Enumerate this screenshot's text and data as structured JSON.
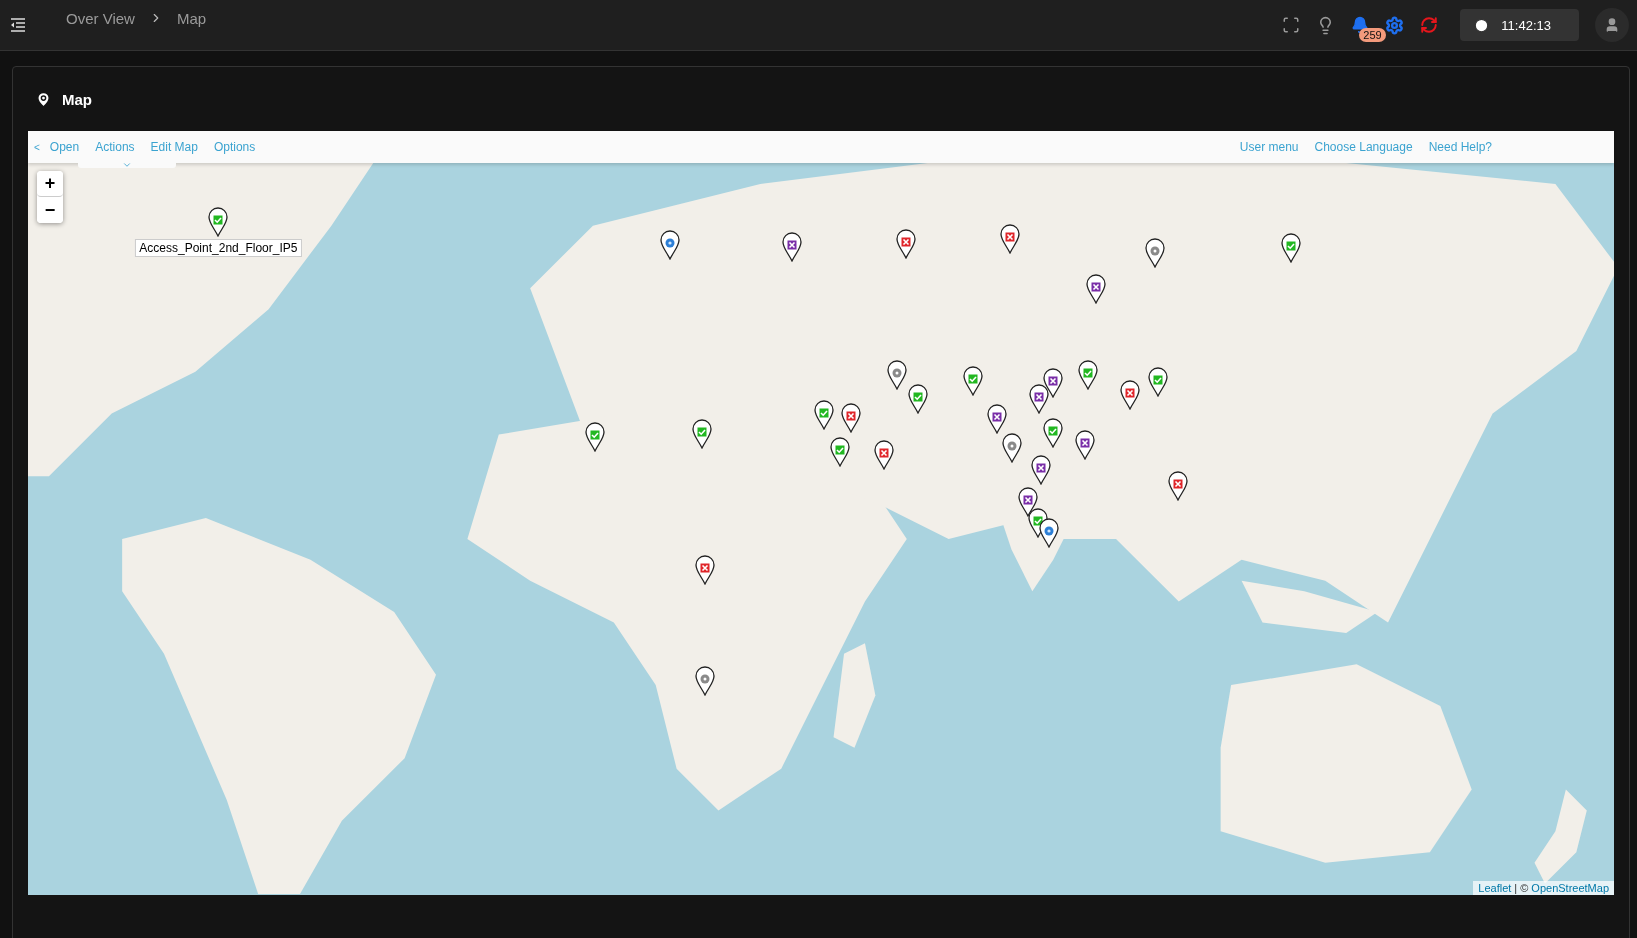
{
  "topbar": {
    "breadcrumbs": [
      {
        "label": "Over View"
      },
      {
        "label": "Map"
      }
    ],
    "notifications": {
      "count": "259"
    },
    "clock": "11:42:13"
  },
  "panel": {
    "title": "Map"
  },
  "map_menu": {
    "back": "<",
    "left": [
      {
        "label": "Open"
      },
      {
        "label": "Actions"
      },
      {
        "label": "Edit Map"
      },
      {
        "label": "Options"
      }
    ],
    "right": [
      {
        "label": "User menu"
      },
      {
        "label": "Choose Language"
      },
      {
        "label": "Need Help?"
      }
    ]
  },
  "zoom_controls": {
    "zoom_in": "+",
    "zoom_out": "−"
  },
  "markers": [
    {
      "kind": "ok",
      "color": "#22b822",
      "tooltip": "Access_Point_2nd_Floor_IP5"
    },
    {
      "kind": "info",
      "color": "#2d7fd6"
    },
    {
      "kind": "down",
      "color": "#7a2ea8"
    },
    {
      "kind": "down",
      "color": "#e0262b"
    },
    {
      "kind": "down",
      "color": "#e0262b"
    },
    {
      "kind": "unknown",
      "color": "#8a8a8a"
    },
    {
      "kind": "ok",
      "color": "#22b822"
    },
    {
      "kind": "down",
      "color": "#7a2ea8"
    },
    {
      "kind": "unknown",
      "color": "#8a8a8a"
    },
    {
      "kind": "ok",
      "color": "#22b822"
    },
    {
      "kind": "ok",
      "color": "#22b822"
    },
    {
      "kind": "down",
      "color": "#7a2ea8"
    },
    {
      "kind": "ok",
      "color": "#22b822"
    },
    {
      "kind": "down",
      "color": "#7a2ea8"
    },
    {
      "kind": "down",
      "color": "#e0262b"
    },
    {
      "kind": "ok",
      "color": "#22b822"
    },
    {
      "kind": "down",
      "color": "#7a2ea8"
    },
    {
      "kind": "ok",
      "color": "#22b822"
    },
    {
      "kind": "unknown",
      "color": "#8a8a8a"
    },
    {
      "kind": "down",
      "color": "#7a2ea8"
    },
    {
      "kind": "down",
      "color": "#7a2ea8"
    },
    {
      "kind": "ok",
      "color": "#22b822"
    },
    {
      "kind": "down",
      "color": "#e0262b"
    },
    {
      "kind": "ok",
      "color": "#22b822"
    },
    {
      "kind": "down",
      "color": "#e0262b"
    },
    {
      "kind": "down",
      "color": "#7a2ea8"
    },
    {
      "kind": "ok",
      "color": "#22b822"
    },
    {
      "kind": "info",
      "color": "#2d7fd6"
    },
    {
      "kind": "down",
      "color": "#e0262b"
    },
    {
      "kind": "ok",
      "color": "#22b822"
    },
    {
      "kind": "ok",
      "color": "#22b822"
    },
    {
      "kind": "down",
      "color": "#e0262b"
    },
    {
      "kind": "unknown",
      "color": "#8a8a8a"
    }
  ],
  "attribution": {
    "links": [
      "Leaflet",
      "OpenStreetMap"
    ],
    "separator": "| ©"
  }
}
